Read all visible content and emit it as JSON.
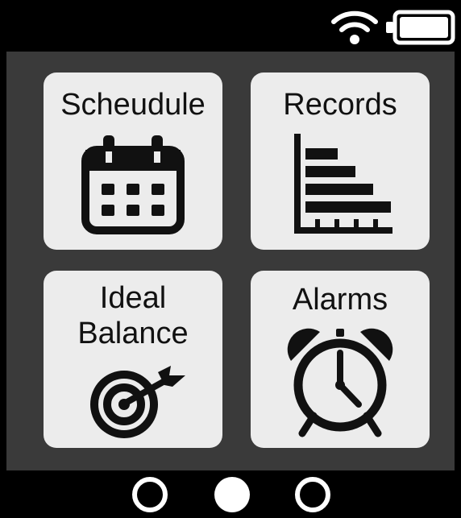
{
  "status_bar": {
    "wifi_icon": "wifi-icon",
    "battery_icon": "battery-icon"
  },
  "tiles": [
    {
      "label": "Scheudule",
      "icon": "calendar-icon"
    },
    {
      "label": "Records",
      "icon": "bar-chart-icon"
    },
    {
      "label": "Ideal\nBalance",
      "icon": "target-icon"
    },
    {
      "label": "Alarms",
      "icon": "alarm-clock-icon"
    }
  ],
  "page_indicator": {
    "pages": 3,
    "active_page": 2
  },
  "colors": {
    "background": "#000000",
    "content_background": "#3a3a3a",
    "tile_background": "#ececec",
    "icon": "#111111"
  }
}
